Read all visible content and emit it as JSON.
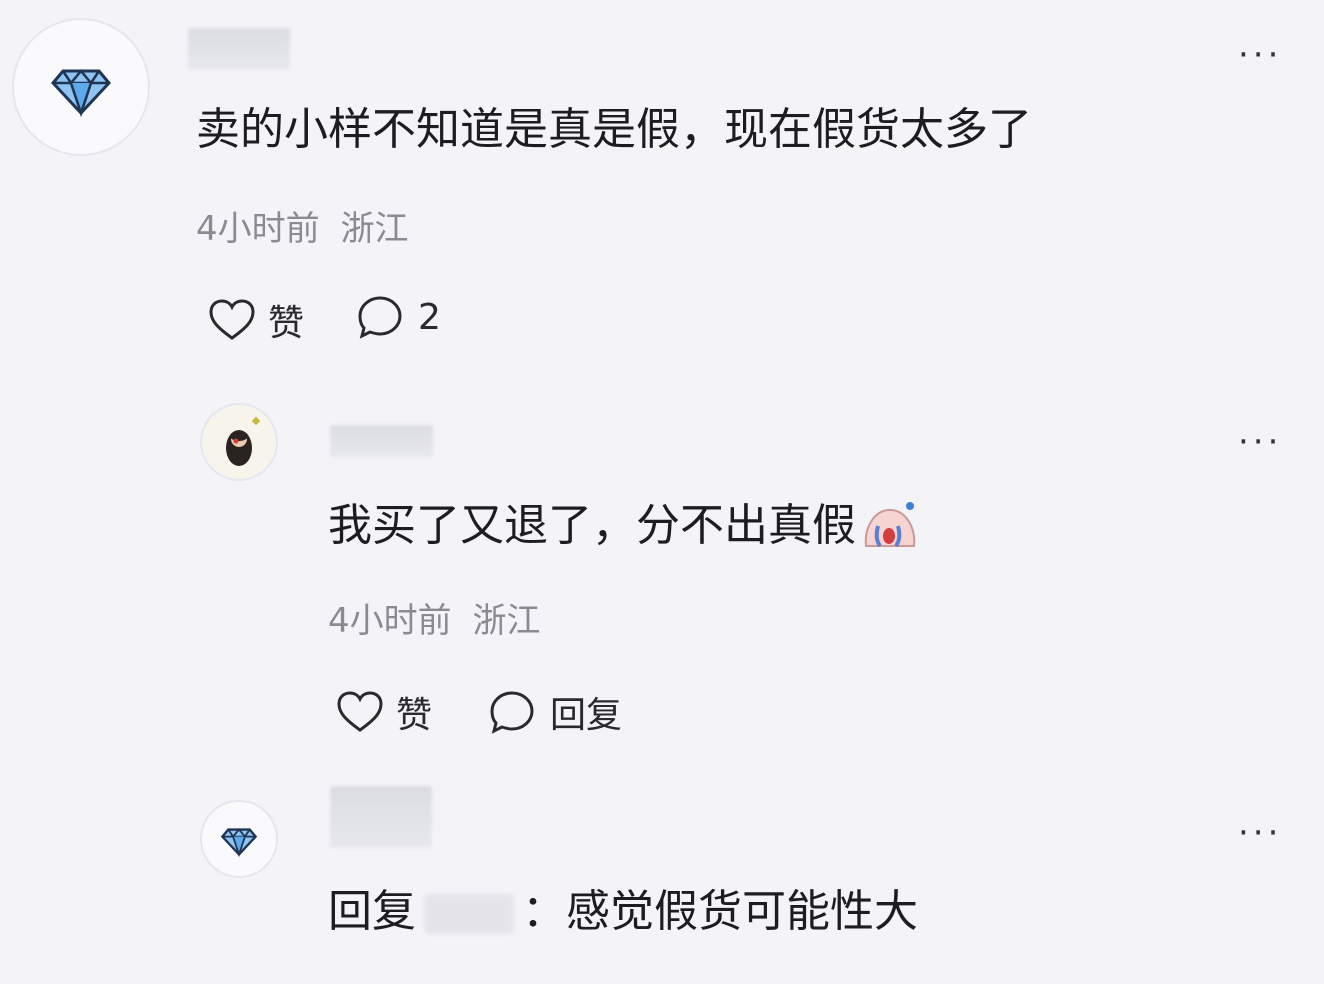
{
  "comments": [
    {
      "text": "卖的小样不知道是真是假，现在假货太多了",
      "time": "4小时前",
      "location": "浙江",
      "like_label": "赞",
      "reply_count": "2"
    },
    {
      "text": "我买了又退了，分不出真假",
      "time": "4小时前",
      "location": "浙江",
      "like_label": "赞",
      "reply_label": "回复"
    },
    {
      "reply_prefix": "回复",
      "reply_suffix": "：感觉假货可能性大"
    }
  ],
  "more_label": "···",
  "colors": {
    "background": "#f4f4f8",
    "text": "#1d1d1f",
    "meta": "#8a8a93",
    "diamond": "#4a90d9"
  }
}
